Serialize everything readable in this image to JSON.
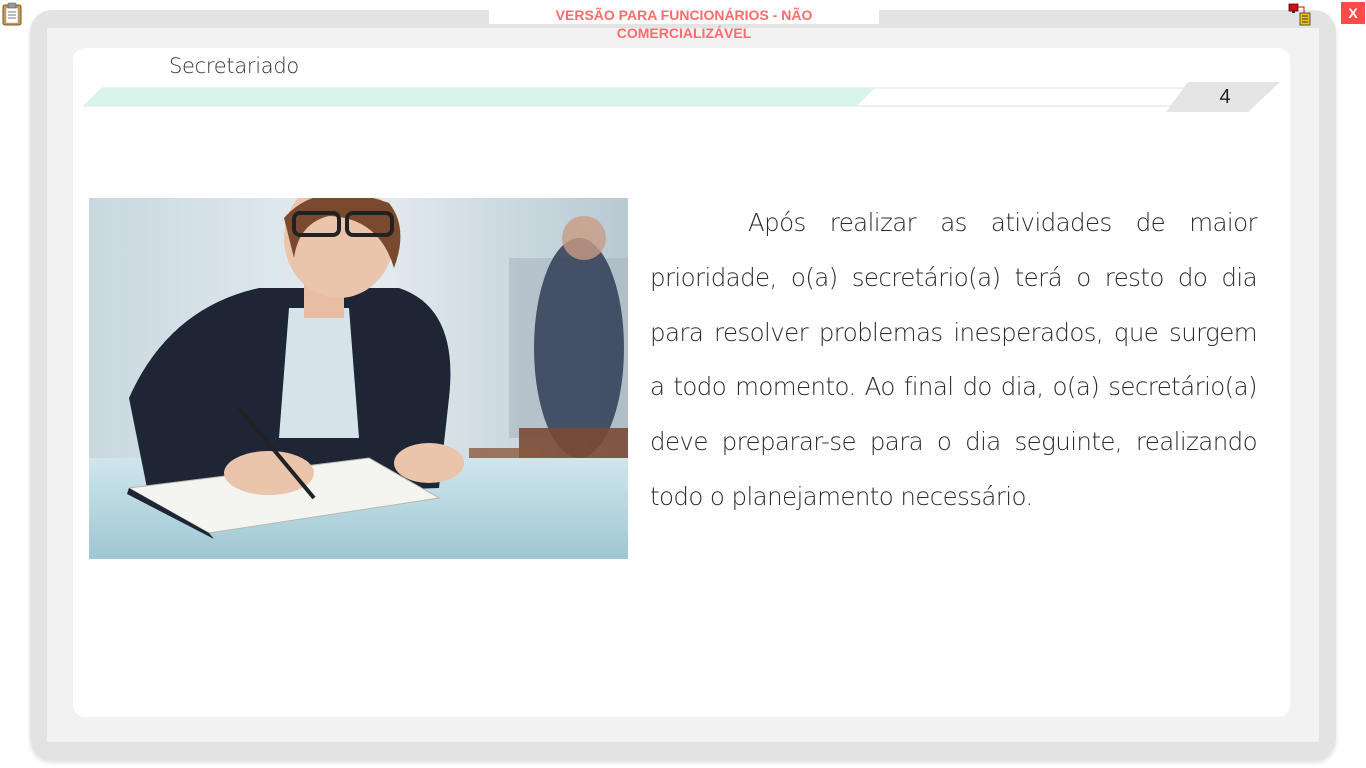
{
  "watermark": "VERSÃO PARA FUNCIONÁRIOS - NÃO COMERCIALIZÁVEL",
  "window": {
    "close_label": "X"
  },
  "header": {
    "section_title": "Secretariado",
    "page_number": "4",
    "progress_fraction": 0.7
  },
  "body": {
    "paragraph": "Após realizar as atividades de maior prioridade, o(a) secretário(a) terá o resto do dia para resolver problemas inesperados, que surgem a todo momento. Ao final do dia, o(a) secretário(a) deve preparar-se para o dia seguinte, realizando todo o planejamento necessário."
  },
  "icons": {
    "clipboard": "clipboard-icon",
    "network": "network-status-icon",
    "close": "close-icon"
  },
  "colors": {
    "progress_fill": "#d7f5ec",
    "watermark": "#ff6b6b",
    "close_button": "#ff4a4a",
    "frame": "#e3e3e3"
  }
}
